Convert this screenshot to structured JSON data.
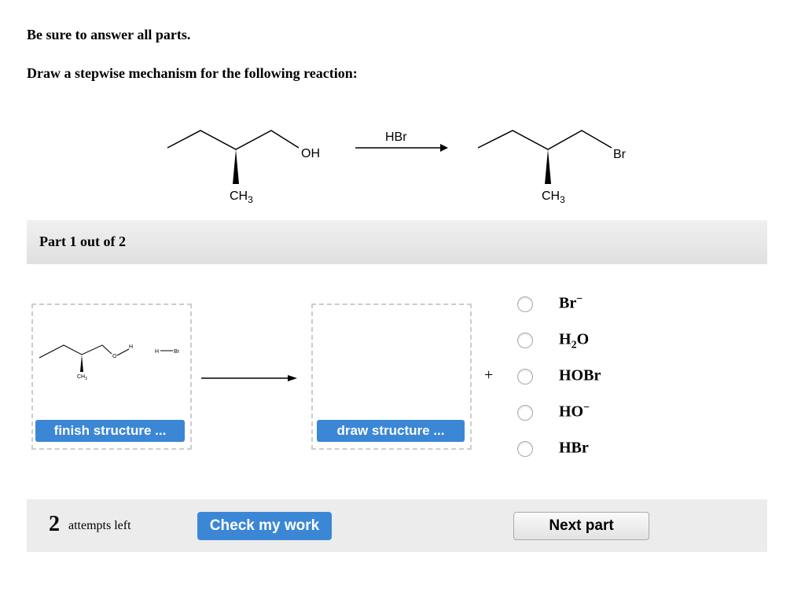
{
  "instructions": {
    "line1": "Be sure to answer all parts.",
    "line2": "Draw a stepwise mechanism for the following reaction:"
  },
  "reaction": {
    "reactant_oh": "OH",
    "reactant_ch3": "CH",
    "reagent": "HBr",
    "product_br": "Br",
    "product_ch3": "CH",
    "subscript3": "3"
  },
  "part": {
    "label": "Part 1 out of 2"
  },
  "step": {
    "left_box": {
      "o": "O",
      "h": "H",
      "hbr_h": "H",
      "hbr_br": "Br",
      "ch3": "CH",
      "sub": "3",
      "button": "finish structure ..."
    },
    "right_box": {
      "button": "draw structure ..."
    },
    "plus": "+",
    "options": [
      {
        "base": "Br",
        "sup": "−",
        "sub": "",
        "tail": ""
      },
      {
        "base": "H",
        "sup": "",
        "sub": "2",
        "tail": "O"
      },
      {
        "base": "HOBr",
        "sup": "",
        "sub": "",
        "tail": ""
      },
      {
        "base": "HO",
        "sup": "−",
        "sub": "",
        "tail": ""
      },
      {
        "base": "HBr",
        "sup": "",
        "sub": "",
        "tail": ""
      }
    ]
  },
  "footer": {
    "attempts_count": "2",
    "attempts_label": "attempts left",
    "check_button": "Check my work",
    "next_button": "Next part"
  },
  "colors": {
    "button_blue": "#3b87d6",
    "part_bar": "#e6e6e6",
    "footer_bg": "#ececec"
  }
}
